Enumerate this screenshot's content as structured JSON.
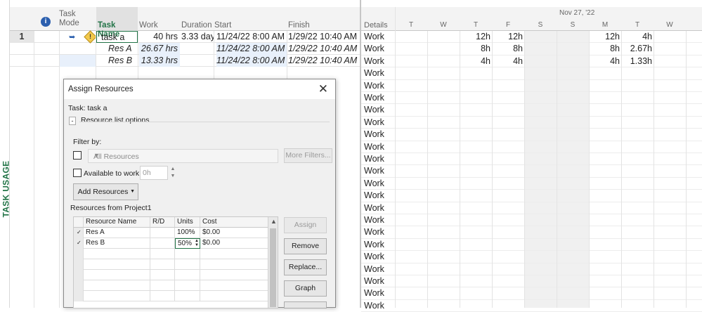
{
  "view_label": "TASK USAGE",
  "table_headers": {
    "task_mode": "Task Mode",
    "task_name": "Task Name",
    "work": "Work",
    "duration": "Duration",
    "start": "Start",
    "finish": "Finish"
  },
  "tasks": [
    {
      "id": "1",
      "name": "task a",
      "work": "40 hrs",
      "duration": "3.33 day",
      "start": "11/24/22 8:00 AM",
      "finish": "1/29/22 10:40 AM"
    },
    {
      "id": "",
      "name": "Res A",
      "work": "26.67 hrs",
      "duration": "",
      "start": "11/24/22 8:00 AM",
      "finish": "1/29/22 10:40 AM"
    },
    {
      "id": "",
      "name": "Res B",
      "work": "13.33 hrs",
      "duration": "",
      "start": "11/24/22 8:00 AM",
      "finish": "1/29/22 10:40 AM"
    }
  ],
  "usage": {
    "details_header": "Details",
    "week_label": "Nov 27, '22",
    "days": [
      "T",
      "W",
      "T",
      "F",
      "S",
      "S",
      "M",
      "T",
      "W"
    ],
    "detail_label": "Work",
    "rows": [
      [
        "",
        "",
        "12h",
        "12h",
        "",
        "",
        "12h",
        "4h",
        ""
      ],
      [
        "",
        "",
        "8h",
        "8h",
        "",
        "",
        "8h",
        "2.67h",
        ""
      ],
      [
        "",
        "",
        "4h",
        "4h",
        "",
        "",
        "4h",
        "1.33h",
        ""
      ]
    ]
  },
  "dialog": {
    "title": "Assign Resources",
    "task_label": "Task: task a",
    "list_options_label": "Resource list options",
    "toggle_symbol": "-",
    "filter_by_label": "Filter by:",
    "filter_value": "All Resources",
    "more_filters_label": "More Filters...",
    "available_label": "Available to work",
    "available_value": "0h",
    "add_resources_label": "Add Resources",
    "resources_from_label": "Resources from Project1",
    "columns": [
      "Resource Name",
      "R/D",
      "Units",
      "Cost"
    ],
    "resources": [
      {
        "name": "Res A",
        "rd": "",
        "units": "100%",
        "cost": "$0.00"
      },
      {
        "name": "Res B",
        "rd": "",
        "units": "50%",
        "cost": "$0.00"
      }
    ],
    "buttons": {
      "assign": "Assign",
      "remove": "Remove",
      "replace": "Replace...",
      "graph": "Graph"
    }
  }
}
